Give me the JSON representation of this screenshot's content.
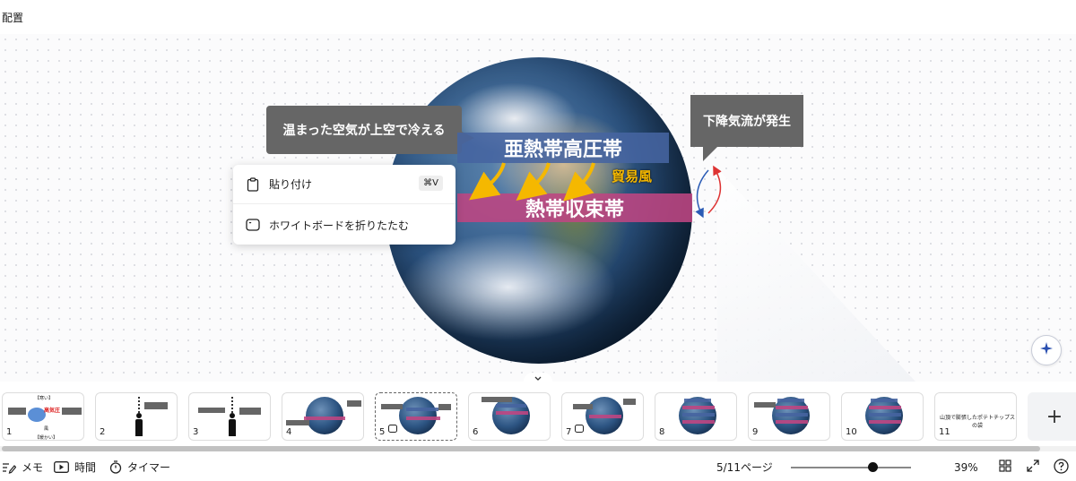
{
  "header": {
    "title": "配置"
  },
  "canvas": {
    "callout_left": "温まった空気が上空で冷える",
    "callout_right": "下降気流が発生",
    "band_top": "亜熱帯高圧帯",
    "band_bottom": "熱帯収束帯",
    "trade_wind": "貿易風"
  },
  "context_menu": {
    "paste_label": "貼り付け",
    "paste_shortcut": "⌘V",
    "collapse_label": "ホワイトボードを折りたたむ"
  },
  "thumbnails": [
    {
      "num": "1"
    },
    {
      "num": "2"
    },
    {
      "num": "3"
    },
    {
      "num": "4"
    },
    {
      "num": "5"
    },
    {
      "num": "6"
    },
    {
      "num": "7"
    },
    {
      "num": "8"
    },
    {
      "num": "9"
    },
    {
      "num": "10"
    },
    {
      "num": "11",
      "text": "山頂で膨張したポテトチップスの袋"
    }
  ],
  "thumb1": {
    "top": "【寒い】",
    "mid": "高気圧",
    "bottom": "【暖かい】",
    "wind": "風"
  },
  "add_page": "+",
  "footer": {
    "notes_label": "メモ",
    "time_label": "時間",
    "timer_label": "タイマー",
    "page_indicator": "5/11ページ",
    "zoom": "39%"
  },
  "zoom_level": 0.68,
  "colors": {
    "band_top": "#4664a0",
    "band_bottom": "#be4682",
    "callout": "#666666",
    "trade_wind": "#f5b800"
  }
}
